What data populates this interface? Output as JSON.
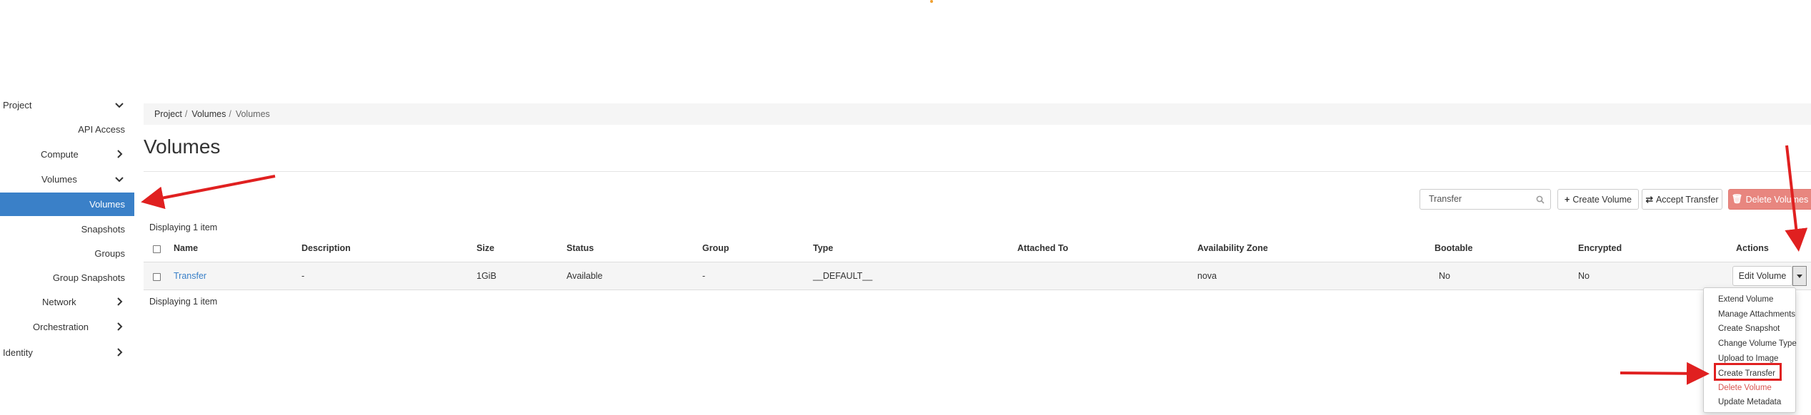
{
  "sidebar": {
    "items": [
      {
        "label": "Project",
        "chevron": "down"
      },
      {
        "label": "API Access"
      },
      {
        "label": "Compute",
        "chevron": "right"
      },
      {
        "label": "Volumes",
        "chevron": "down"
      },
      {
        "label": "Volumes",
        "active": true
      },
      {
        "label": "Snapshots"
      },
      {
        "label": "Groups"
      },
      {
        "label": "Group Snapshots"
      },
      {
        "label": "Network",
        "chevron": "right"
      },
      {
        "label": "Orchestration",
        "chevron": "right"
      },
      {
        "label": "Identity",
        "chevron": "right"
      }
    ]
  },
  "breadcrumb": {
    "items": [
      "Project",
      "Volumes",
      "Volumes"
    ]
  },
  "page": {
    "title": "Volumes"
  },
  "toolbar": {
    "search_value": "Transfer",
    "create_volume": "Create Volume",
    "accept_transfer": "Accept Transfer",
    "delete_volumes": "Delete Volumes"
  },
  "table": {
    "displaying_top": "Displaying 1 item",
    "displaying_bottom": "Displaying 1 item",
    "columns": [
      "Name",
      "Description",
      "Size",
      "Status",
      "Group",
      "Type",
      "Attached To",
      "Availability Zone",
      "Bootable",
      "Encrypted",
      "Actions"
    ],
    "rows": [
      {
        "name": "Transfer",
        "description": "-",
        "size": "1GiB",
        "status": "Available",
        "group": "-",
        "type": "__DEFAULT__",
        "attached_to": "",
        "availability_zone": "nova",
        "bootable": "No",
        "encrypted": "No",
        "action": "Edit Volume"
      }
    ]
  },
  "actions_menu": {
    "items": [
      "Extend Volume",
      "Manage Attachments",
      "Create Snapshot",
      "Change Volume Type",
      "Upload to Image",
      "Create Transfer",
      "Delete Volume",
      "Update Metadata"
    ],
    "highlighted": "Create Transfer"
  },
  "colors": {
    "accent": "#3a80c8",
    "danger": "#d9534f",
    "annotation": "#e02020"
  }
}
